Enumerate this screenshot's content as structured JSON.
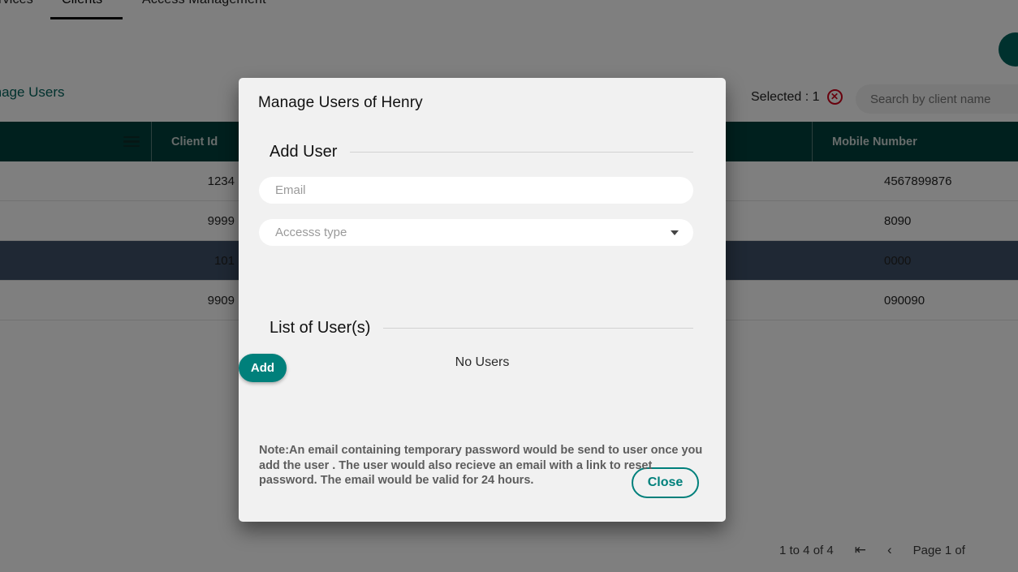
{
  "nav": {
    "tabs": [
      {
        "label": "Services",
        "active": false
      },
      {
        "label": "Clients",
        "active": true
      },
      {
        "label": "Access Management",
        "active": false
      }
    ]
  },
  "toolbar": {
    "manage_users_link": "Manage Users",
    "selected_label": "Selected : 1",
    "clear_selection_icon": "circled-x-icon",
    "search_placeholder": "Search by client name",
    "search_value": "",
    "fab_icon": "avatar-circle"
  },
  "table": {
    "menu_icon": "hamburger-icon",
    "columns": [
      "",
      "Client Id",
      "",
      "Mobile Number"
    ],
    "rows": [
      {
        "client_id": "1234",
        "mobile_number": "4567899876",
        "selected": false
      },
      {
        "client_id": "9999",
        "mobile_number": "8090",
        "selected": false
      },
      {
        "client_id": "101",
        "mobile_number": "0000",
        "selected": true
      },
      {
        "client_id": "9909",
        "mobile_number": "090090",
        "selected": false
      }
    ]
  },
  "pagination": {
    "range_text": "1 to 4 of 4",
    "first_page_icon": "first-page-icon",
    "prev_page_icon": "previous-page-icon",
    "page_text": "Page 1 of"
  },
  "dialog": {
    "title": "Manage Users of Henry",
    "add_user_section": "Add User",
    "email_placeholder": "Email",
    "email_value": "",
    "access_type_placeholder": "Accesss type",
    "access_type_value": "",
    "dropdown_icon": "chevron-down-icon",
    "add_button": "Add",
    "list_section": "List of User(s)",
    "empty_list_text": "No Users",
    "close_button": "Close",
    "note": "Note:An email containing temporary password would be send to user once you add the user . The user would also recieve an email with a link to reset password. The email would be valid for 24 hours."
  },
  "colors": {
    "teal_primary": "#00807b",
    "teal_dark": "#00413c",
    "link_teal": "#00635c",
    "selected_row": "#3f5168",
    "danger_red": "#d0021b",
    "dialog_bg": "#f1f1f1"
  }
}
